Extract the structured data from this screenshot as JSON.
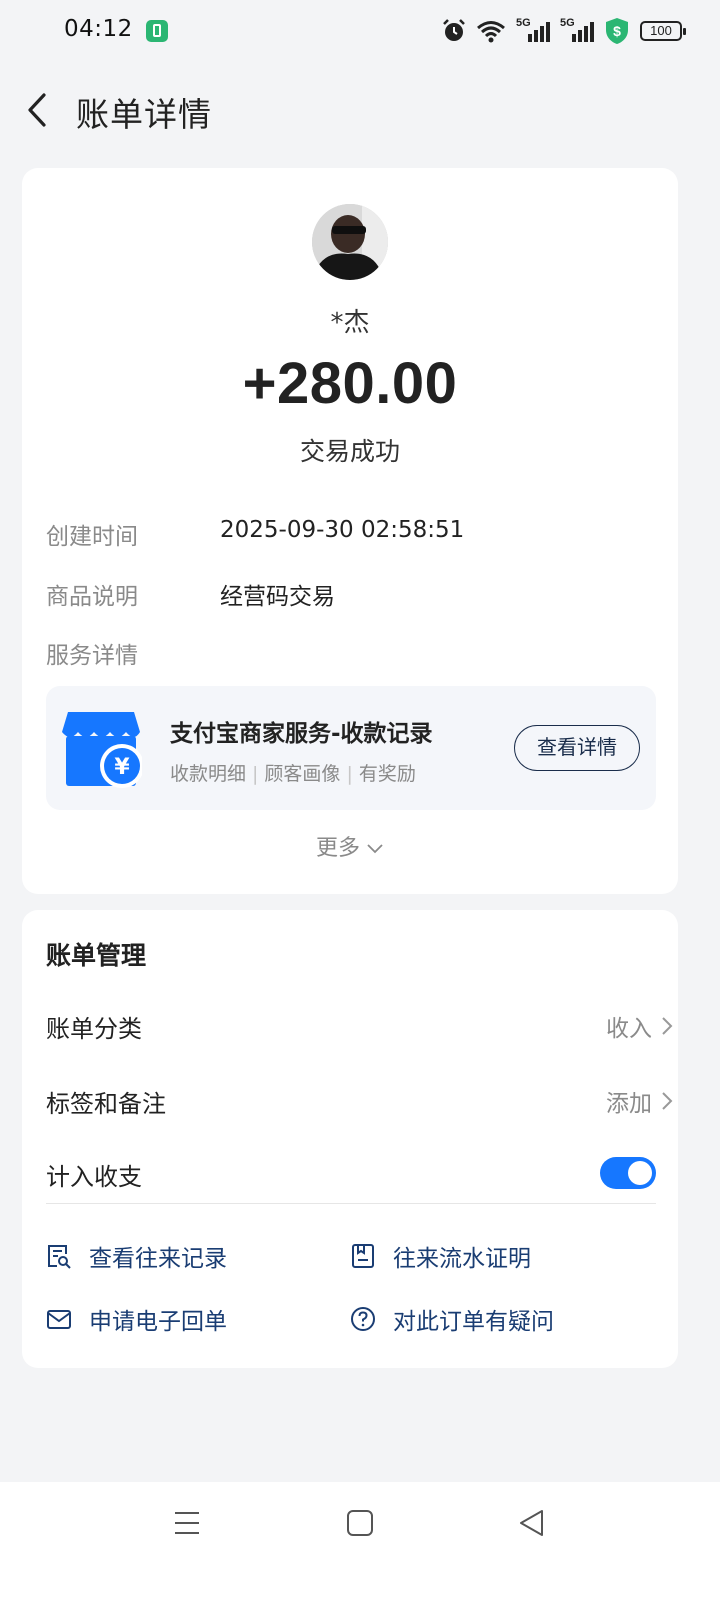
{
  "status_bar": {
    "time": "04:12",
    "network_1": "5G",
    "network_2": "5G",
    "battery": "100",
    "icons": [
      "app-battery-icon",
      "alarm-icon",
      "wifi-icon",
      "signal-icon",
      "signal-icon",
      "shield-dollar-icon",
      "battery-icon"
    ]
  },
  "header": {
    "title": "账单详情",
    "back_icon": "chevron-left-icon"
  },
  "transaction": {
    "payer": "*杰",
    "amount": "+280.00",
    "status": "交易成功",
    "rows": [
      {
        "label": "创建时间",
        "value": "2025-09-30 02:58:51"
      },
      {
        "label": "商品说明",
        "value": "经营码交易"
      },
      {
        "label": "服务详情",
        "value": ""
      }
    ]
  },
  "service": {
    "title": "支付宝商家服务-收款记录",
    "tags": [
      "收款明细",
      "顾客画像",
      "有奖励"
    ],
    "button": "查看详情",
    "icon": "shop-yuan-icon"
  },
  "more": "更多",
  "management": {
    "title": "账单管理",
    "items": [
      {
        "label": "账单分类",
        "value": "收入"
      },
      {
        "label": "标签和备注",
        "value": "添加"
      },
      {
        "label": "计入收支",
        "toggle": true
      }
    ],
    "links": [
      {
        "label": "查看往来记录",
        "icon": "record-search-icon"
      },
      {
        "label": "往来流水证明",
        "icon": "document-icon"
      },
      {
        "label": "申请电子回单",
        "icon": "mail-icon"
      },
      {
        "label": "对此订单有疑问",
        "icon": "question-icon"
      }
    ]
  },
  "colors": {
    "background": "#f3f4f6",
    "accent_blue": "#1677ff",
    "link_text": "#1a3d73"
  }
}
